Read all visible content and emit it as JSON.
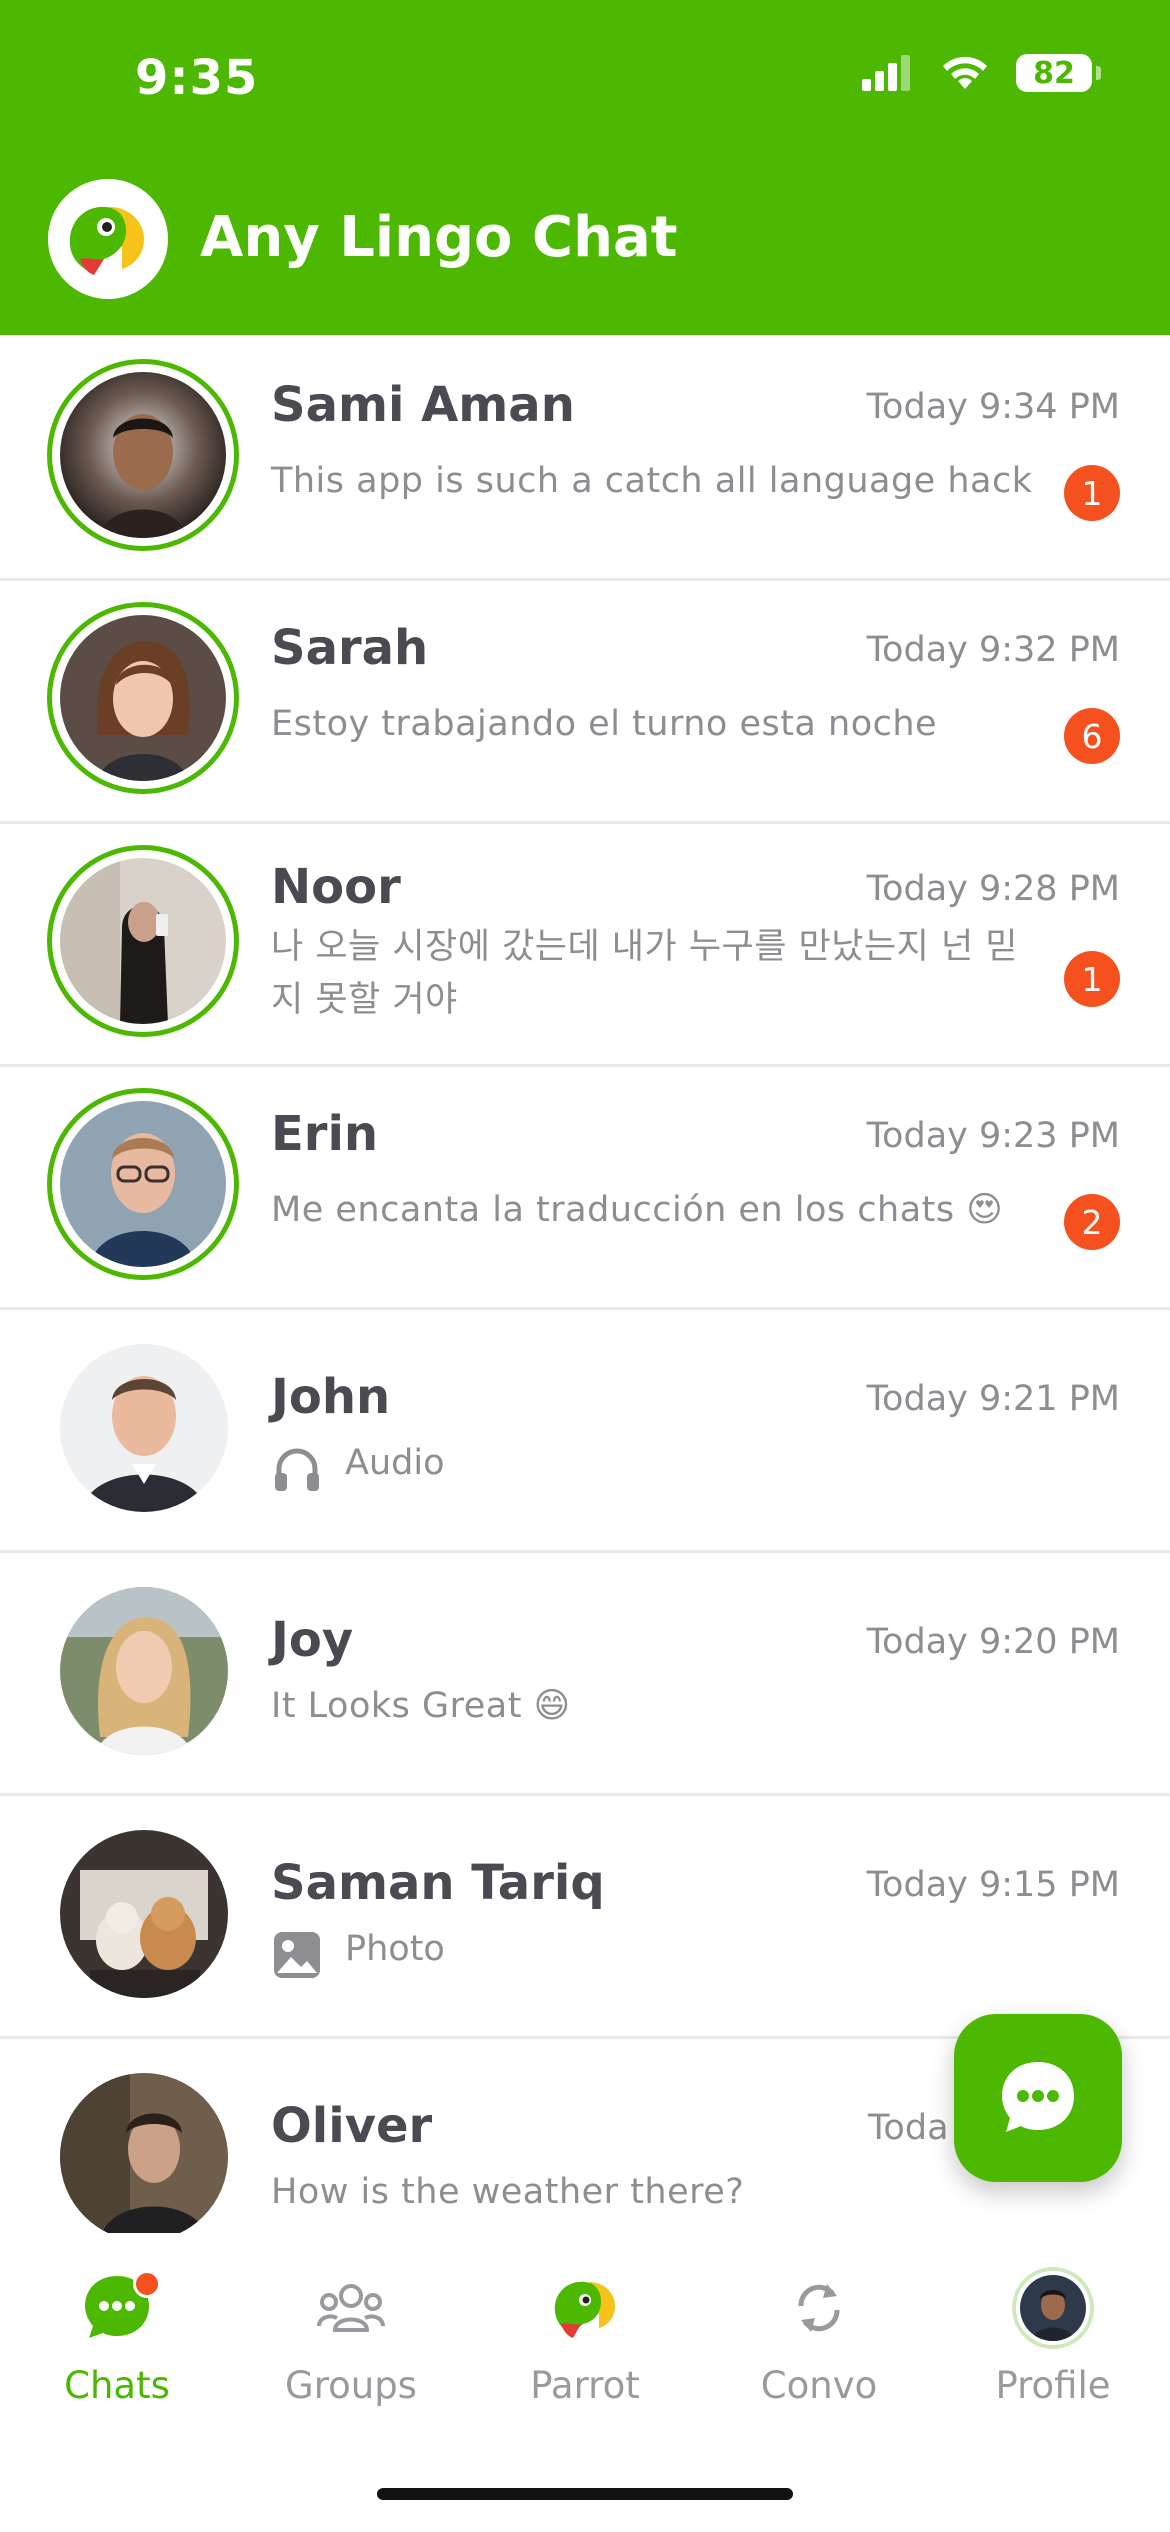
{
  "status_bar": {
    "time": "9:35",
    "battery": "82"
  },
  "header": {
    "title": "Any Lingo Chat"
  },
  "chats": [
    {
      "name": "Sami Aman",
      "time": "Today 9:34 PM",
      "message": "This app is such a catch all language hack",
      "unread": "1"
    },
    {
      "name": "Sarah",
      "time": "Today 9:32 PM",
      "message": "Estoy trabajando el turno esta noche",
      "unread": "6"
    },
    {
      "name": "Noor",
      "time": "Today 9:28 PM",
      "message": "나 오늘 시장에 갔는데 내가 누구를 만났는지 넌 믿지 못할 거야",
      "unread": "1"
    },
    {
      "name": "Erin",
      "time": "Today 9:23 PM",
      "message": "Me encanta la traducción en los chats 😍",
      "unread": "2"
    },
    {
      "name": "John",
      "time": "Today 9:21 PM",
      "message": "Audio",
      "message_icon": "headphones-icon"
    },
    {
      "name": "Joy",
      "time": "Today 9:20 PM",
      "message": "It Looks Great 😄"
    },
    {
      "name": "Saman Tariq",
      "time": "Today 9:15 PM",
      "message": "Photo",
      "message_icon": "image-icon"
    },
    {
      "name": "Oliver",
      "time": "Toda",
      "message": "How is the weather there?"
    }
  ],
  "tabs": [
    {
      "label": "Chats",
      "icon": "chat-bubble-icon",
      "active": true
    },
    {
      "label": "Groups",
      "icon": "groups-icon"
    },
    {
      "label": "Parrot",
      "icon": "parrot-icon"
    },
    {
      "label": "Convo",
      "icon": "sync-icon"
    },
    {
      "label": "Profile",
      "icon": "profile-avatar"
    }
  ],
  "colors": {
    "brand_green": "#4cb802",
    "badge_orange": "#f4511e"
  }
}
